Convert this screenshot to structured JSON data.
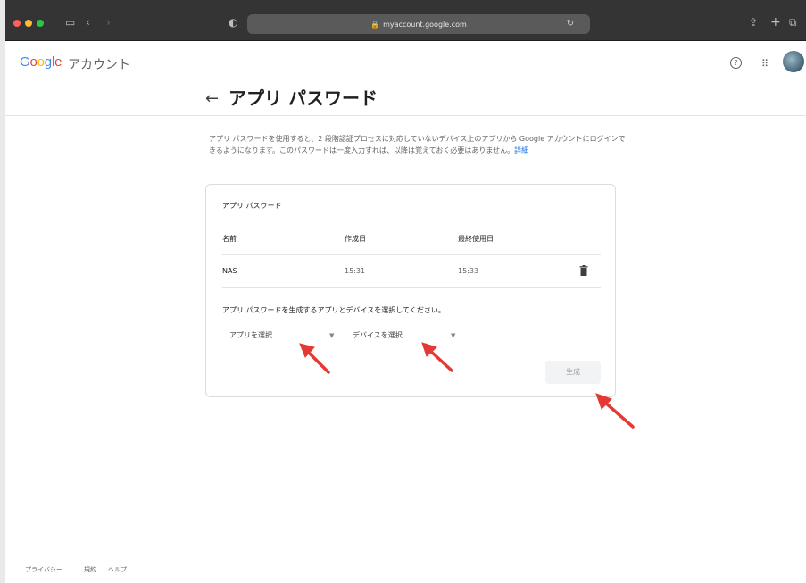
{
  "browser": {
    "url": "myaccount.google.com"
  },
  "header": {
    "logo_parts": [
      "G",
      "o",
      "o",
      "g",
      "l",
      "e"
    ],
    "account_label": "アカウント"
  },
  "page": {
    "title": "アプリ パスワード",
    "description": "アプリ パスワードを使用すると、2 段階認証プロセスに対応していないデバイス上のアプリから Google アカウントにログインできるようになります。このパスワードは一度入力すれば、以降は覚えておく必要はありません。",
    "details_link": "詳細"
  },
  "card": {
    "title": "アプリ パスワード",
    "columns": {
      "name": "名前",
      "created": "作成日",
      "last_used": "最終使用日"
    },
    "rows": [
      {
        "name": "NAS",
        "created": "15:31",
        "last_used": "15:33"
      }
    ],
    "instruction": "アプリ パスワードを生成するアプリとデバイスを選択してください。",
    "app_select": "アプリを選択",
    "device_select": "デバイスを選択",
    "generate_button": "生成"
  },
  "footer": {
    "privacy": "プライバシー",
    "terms": "規約",
    "help": "ヘルプ"
  },
  "colors": {
    "accent_blue": "#1a73e8",
    "annotation_red": "#e53935"
  }
}
